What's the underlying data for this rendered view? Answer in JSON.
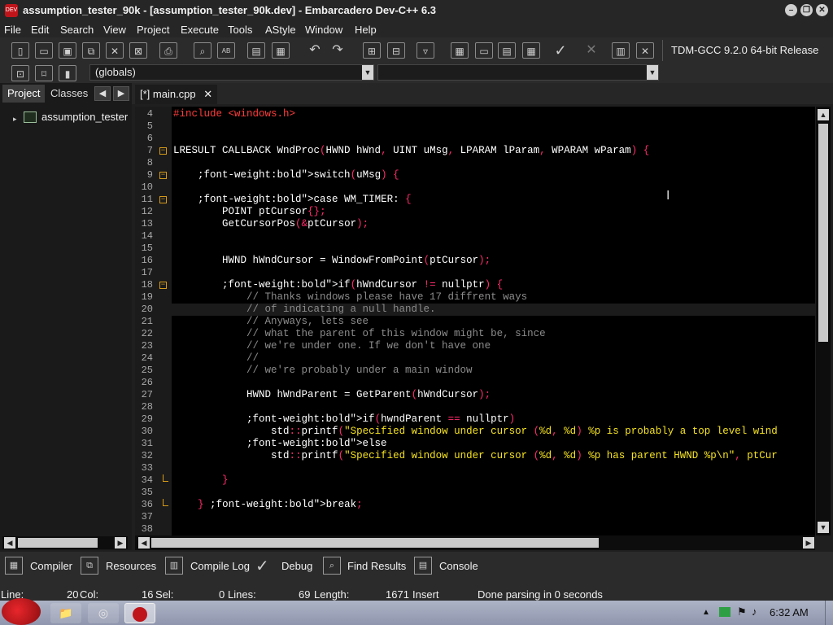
{
  "window": {
    "title": "assumption_tester_90k - [assumption_tester_90k.dev] - Embarcadero Dev-C++ 6.3",
    "app_icon_text": "DEV"
  },
  "menu": [
    "File",
    "Edit",
    "Search",
    "View",
    "Project",
    "Execute",
    "Tools",
    "AStyle",
    "Window",
    "Help"
  ],
  "toolbar": {
    "compiler": "TDM-GCC 9.2.0 64-bit Release",
    "scope_combo": "(globals)",
    "icons": [
      "new-file-icon",
      "open-icon",
      "save-icon",
      "save-all-icon",
      "close-icon",
      "close-all-icon",
      "print-icon",
      "find-icon",
      "replace-icon",
      "goto-icon",
      "toggle-icon",
      "undo-icon",
      "redo-icon",
      "new-class-icon",
      "properties-icon",
      "comment-icon",
      "compile-icon",
      "run-icon",
      "compile-run-icon",
      "rebuild-icon",
      "check-icon",
      "abort-icon",
      "chart-icon",
      "delete-icon"
    ]
  },
  "left_panel": {
    "tabs": [
      "Project",
      "Classes"
    ],
    "tree_item": "assumption_tester"
  },
  "editor": {
    "tab_label": "[*] main.cpp",
    "lines": [
      {
        "n": "4",
        "code": "#include <windows.h>",
        "type": "preproc"
      },
      {
        "n": "5",
        "code": "",
        "type": "plain"
      },
      {
        "n": "6",
        "code": "",
        "type": "plain"
      },
      {
        "n": "7",
        "code": "LRESULT CALLBACK WndProc(HWND hWnd, UINT uMsg, LPARAM lParam, WPARAM wParam) {",
        "type": "plain",
        "fold": true
      },
      {
        "n": "8",
        "code": "",
        "type": "plain"
      },
      {
        "n": "9",
        "code": "    switch(uMsg) {",
        "type": "keyword",
        "fold": true
      },
      {
        "n": "10",
        "code": "",
        "type": "plain"
      },
      {
        "n": "11",
        "code": "    case WM_TIMER: {",
        "type": "keyword",
        "fold": true
      },
      {
        "n": "12",
        "code": "        POINT ptCursor{};",
        "type": "plain"
      },
      {
        "n": "13",
        "code": "        GetCursorPos(&ptCursor);",
        "type": "plain"
      },
      {
        "n": "14",
        "code": "",
        "type": "plain"
      },
      {
        "n": "15",
        "code": "",
        "type": "plain"
      },
      {
        "n": "16",
        "code": "        HWND hWndCursor = WindowFromPoint(ptCursor);",
        "type": "plain"
      },
      {
        "n": "17",
        "code": "",
        "type": "plain"
      },
      {
        "n": "18",
        "code": "        if(hWndCursor != nullptr) {",
        "type": "keyword",
        "fold": true
      },
      {
        "n": "19",
        "code": "            // Thanks windows please have 17 diffrent ways",
        "type": "comment"
      },
      {
        "n": "20",
        "code": "            // of indicating a null handle.",
        "type": "comment",
        "current": true
      },
      {
        "n": "21",
        "code": "            // Anyways, lets see",
        "type": "comment"
      },
      {
        "n": "22",
        "code": "            // what the parent of this window might be, since",
        "type": "comment"
      },
      {
        "n": "23",
        "code": "            // we're under one. If we don't have one",
        "type": "comment"
      },
      {
        "n": "24",
        "code": "            //",
        "type": "comment"
      },
      {
        "n": "25",
        "code": "            // we're probably under a main window",
        "type": "comment"
      },
      {
        "n": "26",
        "code": "",
        "type": "plain"
      },
      {
        "n": "27",
        "code": "            HWND hWndParent = GetParent(hWndCursor);",
        "type": "plain"
      },
      {
        "n": "28",
        "code": "",
        "type": "plain"
      },
      {
        "n": "29",
        "code": "            if(hwndParent == nullptr)",
        "type": "keyword"
      },
      {
        "n": "30",
        "code": "                std::printf(\"Specified window under cursor (%d, %d) %p is probably a top level wind",
        "type": "string"
      },
      {
        "n": "31",
        "code": "            else",
        "type": "keyword"
      },
      {
        "n": "32",
        "code": "                std::printf(\"Specified window under cursor (%d, %d) %p has parent HWND %p\\n\", ptCur",
        "type": "string"
      },
      {
        "n": "33",
        "code": "",
        "type": "plain"
      },
      {
        "n": "34",
        "code": "        }",
        "type": "plain",
        "fold_end": true
      },
      {
        "n": "35",
        "code": "",
        "type": "plain"
      },
      {
        "n": "36",
        "code": "    } break;",
        "type": "keyword",
        "fold_end": true
      },
      {
        "n": "37",
        "code": "",
        "type": "plain"
      },
      {
        "n": "38",
        "code": "",
        "type": "plain"
      }
    ]
  },
  "bottom_tabs": [
    {
      "label": "Compiler",
      "icon": "grid-icon"
    },
    {
      "label": "Resources",
      "icon": "resources-icon"
    },
    {
      "label": "Compile Log",
      "icon": "chart-icon"
    },
    {
      "label": "Debug",
      "icon": "check-icon"
    },
    {
      "label": "Find Results",
      "icon": "find-icon"
    },
    {
      "label": "Console",
      "icon": "console-icon"
    }
  ],
  "status": {
    "line_label": "Line:",
    "line_value": "20",
    "col_label": "Col:",
    "col_value": "16",
    "sel_label": "Sel:",
    "sel_value": "0",
    "lines_label": "Lines:",
    "lines_value": "69",
    "length_label": "Length:",
    "length_value": "1671",
    "mode": "Insert",
    "message": "Done parsing in 0 seconds"
  },
  "taskbar": {
    "clock": "6:32 AM"
  },
  "colors": {
    "keyword": "#ff2b6b",
    "preproc": "#ff3b3b",
    "comment": "#8c8c8c",
    "string": "#f5e21e",
    "plain": "#ffffff",
    "gutter_fold": "#d79b16"
  }
}
